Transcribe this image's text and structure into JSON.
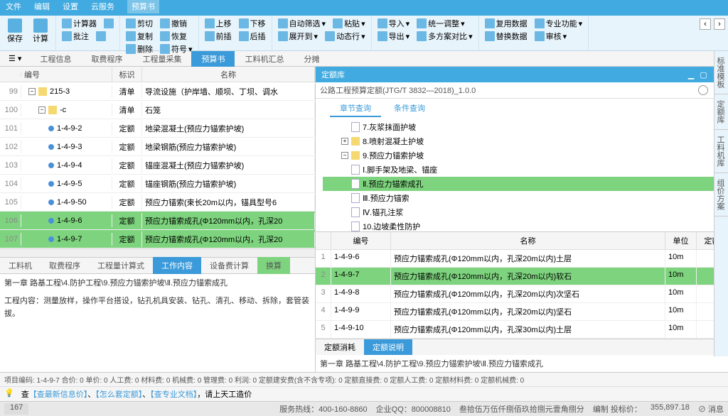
{
  "top_menu": [
    "文件",
    "编辑",
    "设置",
    "云服务",
    "预算书",
    "",
    "",
    "",
    "",
    ""
  ],
  "ribbon": {
    "big": [
      {
        "label": "保存"
      },
      {
        "label": "计算"
      }
    ],
    "g1": [
      [
        "计算器",
        "批注"
      ],
      [
        "批注",
        "批注"
      ]
    ],
    "g2": [
      [
        "剪切",
        "撤销"
      ],
      [
        "复制",
        "恢复"
      ],
      [
        "删除",
        "符号"
      ]
    ],
    "g3": [
      [
        "上移",
        "下移"
      ],
      [
        "前插",
        "后插"
      ]
    ],
    "g4": [
      [
        "自动筛选"
      ],
      [
        "展开到"
      ],
      [
        "粘贴"
      ],
      [
        "动态行"
      ]
    ],
    "g5": [
      [
        "导入",
        "统一调整"
      ],
      [
        "导出",
        "多方案对比"
      ]
    ],
    "g6": [
      [
        "复用数据",
        "专业功能"
      ],
      [
        "替换数据",
        "审核"
      ]
    ]
  },
  "doc_tabs": [
    "工程信息",
    "取费程序",
    "工程量采集",
    "预算书",
    "工料机汇总",
    "分摊"
  ],
  "doc_tabs_active": 3,
  "left_grid": {
    "headers": [
      "",
      "编号",
      "标识",
      "名称"
    ],
    "rows": [
      {
        "idx": "99",
        "code": "215-3",
        "mark": "清单",
        "name": "导流设施（护岸墙、顺坝、丁坝、调水",
        "type": "group"
      },
      {
        "idx": "100",
        "code": "-c",
        "mark": "清单",
        "name": "石笼",
        "type": "group2"
      },
      {
        "idx": "101",
        "code": "1-4-9-2",
        "mark": "定额",
        "name": "地梁混凝土(预应力锚索护坡)",
        "type": "item"
      },
      {
        "idx": "102",
        "code": "1-4-9-3",
        "mark": "定额",
        "name": "地梁钢筋(预应力锚索护坡)",
        "type": "item"
      },
      {
        "idx": "103",
        "code": "1-4-9-4",
        "mark": "定额",
        "name": "锚座混凝土(预应力锚索护坡)",
        "type": "item"
      },
      {
        "idx": "104",
        "code": "1-4-9-5",
        "mark": "定额",
        "name": "锚座钢筋(预应力锚索护坡)",
        "type": "item"
      },
      {
        "idx": "105",
        "code": "1-4-9-50",
        "mark": "定额",
        "name": "预应力锚索(束长20m以内，锚具型号6",
        "type": "item"
      },
      {
        "idx": "106",
        "code": "1-4-9-6",
        "mark": "定额",
        "name": "预应力锚索成孔(Φ120mm以内，孔深20",
        "type": "item",
        "hl": true
      },
      {
        "idx": "107",
        "code": "1-4-9-7",
        "mark": "定额",
        "name": "预应力锚索成孔(Φ120mm以内，孔深20",
        "type": "item",
        "hl": true
      }
    ]
  },
  "sub_tabs": [
    "工料机",
    "取费程序",
    "工程量计算式",
    "工作内容",
    "设备费计算",
    "换算"
  ],
  "sub_tabs_active": 3,
  "breadcrumb_left": "第一章 路基工程\\4.防护工程\\9.预应力锚索护坡\\Ⅱ.预应力锚索成孔",
  "work_content": "工程内容：测量放样，操作平台搭设，钻孔机具安装、钻孔、清孔、移动、拆除，套管装拔。",
  "right": {
    "title": "定额库",
    "subtitle": "公路工程预算定额(JTG/T 3832—2018)_1.0.0",
    "tabs": [
      "章节查询",
      "条件查询"
    ],
    "tree": [
      {
        "label": "7.灰浆抹面护坡",
        "indent": 40,
        "ic": "doc"
      },
      {
        "label": "8.喷射混凝土护坡",
        "indent": 26,
        "ic": "plus"
      },
      {
        "label": "9.预应力锚索护坡",
        "indent": 26,
        "ic": "minus"
      },
      {
        "label": "Ⅰ.脚手架及地梁、锚座",
        "indent": 40,
        "ic": "doc"
      },
      {
        "label": "Ⅱ.预应力锚索成孔",
        "indent": 40,
        "ic": "doc",
        "sel": true
      },
      {
        "label": "Ⅲ.预应力锚索",
        "indent": 40,
        "ic": "doc"
      },
      {
        "label": "Ⅳ.锚孔注浆",
        "indent": 40,
        "ic": "doc"
      },
      {
        "label": "10.边坡柔性防护",
        "indent": 40,
        "ic": "doc"
      }
    ],
    "grid_headers": [
      "",
      "编号",
      "名称",
      "单位",
      "定额"
    ],
    "grid_rows": [
      {
        "idx": "1",
        "code": "1-4-9-6",
        "name": "预应力锚索成孔(Φ120mm以内，孔深20m以内)土层",
        "unit": "10m"
      },
      {
        "idx": "2",
        "code": "1-4-9-7",
        "name": "预应力锚索成孔(Φ120mm以内，孔深20m以内)软石",
        "unit": "10m",
        "hl": true
      },
      {
        "idx": "3",
        "code": "1-4-9-8",
        "name": "预应力锚索成孔(Φ120mm以内，孔深20m以内)次坚石",
        "unit": "10m"
      },
      {
        "idx": "4",
        "code": "1-4-9-9",
        "name": "预应力锚索成孔(Φ120mm以内，孔深20m以内)坚石",
        "unit": "10m"
      },
      {
        "idx": "5",
        "code": "1-4-9-10",
        "name": "预应力锚索成孔(Φ120mm以内，孔深30m以内)土层",
        "unit": "10m"
      }
    ],
    "bottom_tabs": [
      "定额消耗",
      "定额说明"
    ],
    "bottom_breadcrumb": "第一章 路基工程\\4.防护工程\\9.预应力锚索护坡\\Ⅱ.预应力锚索成孔"
  },
  "footer1": "项目编码: 1-4-9-7  合价: 0  单价: 0  人工费: 0  材料费: 0  机械费: 0  管理费: 0  利润: 0  定额建安费(含不含专项): 0  定额直接费: 0  定额人工费: 0  定额材料费: 0  定额机械费: 0",
  "footer2": {
    "a": "【查最新信息价】",
    "b": "【怎么套定额】",
    "c": "【查专业文档】",
    "d": "，请上天工造价"
  },
  "status": {
    "hotline": "服务热线：400-160-8860",
    "qq": "企业QQ：800008810",
    "amount": "叁拾伍万伍仟捌佰玖拾捌元壹角捌分",
    "edit": "编制 投标价：",
    "price": "355,897.18",
    "msg": "消息"
  },
  "side": [
    "标准模板",
    "定额库",
    "工料机库",
    "组价方案"
  ],
  "pagenum": "167"
}
